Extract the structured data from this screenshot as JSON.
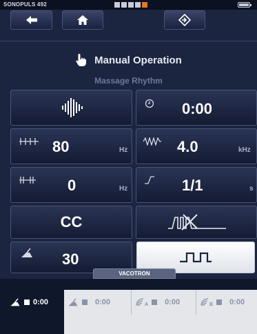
{
  "status": {
    "device": "SONOPULS 492"
  },
  "header": {
    "title": "Manual Operation",
    "subtitle": "Massage Rhythm"
  },
  "params": {
    "time": "0:00",
    "frequency": {
      "value": "80",
      "unit": "Hz"
    },
    "carrier": {
      "value": "4.0",
      "unit": "kHz"
    },
    "offset": {
      "value": "0",
      "unit": "Hz"
    },
    "ramp": {
      "value": "1/1",
      "unit": "s"
    },
    "mode": "CC",
    "intensity": "30"
  },
  "vacotron": {
    "label": "VACOTRON"
  },
  "channels": [
    {
      "letter": "",
      "time": "0:00"
    },
    {
      "letter": "",
      "time": "0:00"
    },
    {
      "letter": "A",
      "time": "0:00"
    },
    {
      "letter": "B",
      "time": "0:00"
    }
  ],
  "colors": {
    "accent": "#e8781a",
    "background": "#1b2540",
    "panel_light": "#e4e6ea"
  }
}
